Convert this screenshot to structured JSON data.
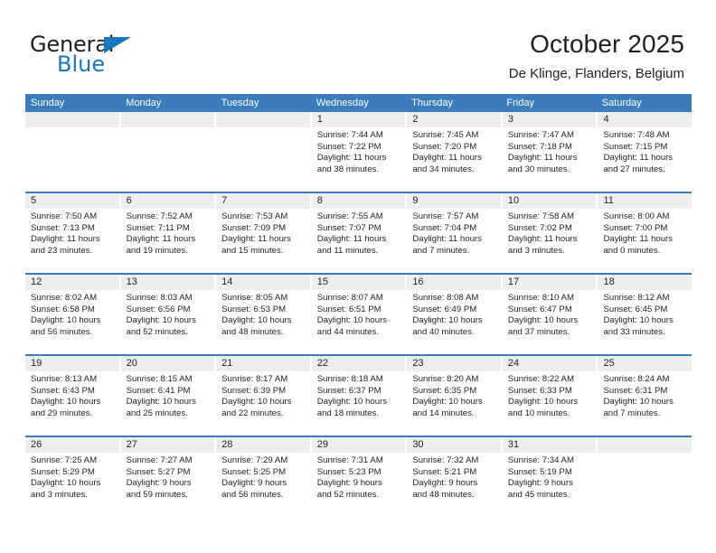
{
  "brand": {
    "name_part1": "General",
    "name_part2": "Blue",
    "accent_color": "#1878be",
    "triangle_icon": "triangle-icon"
  },
  "header": {
    "title": "October 2025",
    "location": "De Klinge, Flanders, Belgium",
    "header_bg_color": "#3b7cbd",
    "daynum_bg_color": "#eeeeee"
  },
  "weekdays": [
    "Sunday",
    "Monday",
    "Tuesday",
    "Wednesday",
    "Thursday",
    "Friday",
    "Saturday"
  ],
  "weeks": [
    [
      {
        "day": "",
        "lines": []
      },
      {
        "day": "",
        "lines": []
      },
      {
        "day": "",
        "lines": []
      },
      {
        "day": "1",
        "lines": [
          "Sunrise: 7:44 AM",
          "Sunset: 7:22 PM",
          "Daylight: 11 hours",
          "and 38 minutes."
        ]
      },
      {
        "day": "2",
        "lines": [
          "Sunrise: 7:45 AM",
          "Sunset: 7:20 PM",
          "Daylight: 11 hours",
          "and 34 minutes."
        ]
      },
      {
        "day": "3",
        "lines": [
          "Sunrise: 7:47 AM",
          "Sunset: 7:18 PM",
          "Daylight: 11 hours",
          "and 30 minutes."
        ]
      },
      {
        "day": "4",
        "lines": [
          "Sunrise: 7:48 AM",
          "Sunset: 7:15 PM",
          "Daylight: 11 hours",
          "and 27 minutes."
        ]
      }
    ],
    [
      {
        "day": "5",
        "lines": [
          "Sunrise: 7:50 AM",
          "Sunset: 7:13 PM",
          "Daylight: 11 hours",
          "and 23 minutes."
        ]
      },
      {
        "day": "6",
        "lines": [
          "Sunrise: 7:52 AM",
          "Sunset: 7:11 PM",
          "Daylight: 11 hours",
          "and 19 minutes."
        ]
      },
      {
        "day": "7",
        "lines": [
          "Sunrise: 7:53 AM",
          "Sunset: 7:09 PM",
          "Daylight: 11 hours",
          "and 15 minutes."
        ]
      },
      {
        "day": "8",
        "lines": [
          "Sunrise: 7:55 AM",
          "Sunset: 7:07 PM",
          "Daylight: 11 hours",
          "and 11 minutes."
        ]
      },
      {
        "day": "9",
        "lines": [
          "Sunrise: 7:57 AM",
          "Sunset: 7:04 PM",
          "Daylight: 11 hours",
          "and 7 minutes."
        ]
      },
      {
        "day": "10",
        "lines": [
          "Sunrise: 7:58 AM",
          "Sunset: 7:02 PM",
          "Daylight: 11 hours",
          "and 3 minutes."
        ]
      },
      {
        "day": "11",
        "lines": [
          "Sunrise: 8:00 AM",
          "Sunset: 7:00 PM",
          "Daylight: 11 hours",
          "and 0 minutes."
        ]
      }
    ],
    [
      {
        "day": "12",
        "lines": [
          "Sunrise: 8:02 AM",
          "Sunset: 6:58 PM",
          "Daylight: 10 hours",
          "and 56 minutes."
        ]
      },
      {
        "day": "13",
        "lines": [
          "Sunrise: 8:03 AM",
          "Sunset: 6:56 PM",
          "Daylight: 10 hours",
          "and 52 minutes."
        ]
      },
      {
        "day": "14",
        "lines": [
          "Sunrise: 8:05 AM",
          "Sunset: 6:53 PM",
          "Daylight: 10 hours",
          "and 48 minutes."
        ]
      },
      {
        "day": "15",
        "lines": [
          "Sunrise: 8:07 AM",
          "Sunset: 6:51 PM",
          "Daylight: 10 hours",
          "and 44 minutes."
        ]
      },
      {
        "day": "16",
        "lines": [
          "Sunrise: 8:08 AM",
          "Sunset: 6:49 PM",
          "Daylight: 10 hours",
          "and 40 minutes."
        ]
      },
      {
        "day": "17",
        "lines": [
          "Sunrise: 8:10 AM",
          "Sunset: 6:47 PM",
          "Daylight: 10 hours",
          "and 37 minutes."
        ]
      },
      {
        "day": "18",
        "lines": [
          "Sunrise: 8:12 AM",
          "Sunset: 6:45 PM",
          "Daylight: 10 hours",
          "and 33 minutes."
        ]
      }
    ],
    [
      {
        "day": "19",
        "lines": [
          "Sunrise: 8:13 AM",
          "Sunset: 6:43 PM",
          "Daylight: 10 hours",
          "and 29 minutes."
        ]
      },
      {
        "day": "20",
        "lines": [
          "Sunrise: 8:15 AM",
          "Sunset: 6:41 PM",
          "Daylight: 10 hours",
          "and 25 minutes."
        ]
      },
      {
        "day": "21",
        "lines": [
          "Sunrise: 8:17 AM",
          "Sunset: 6:39 PM",
          "Daylight: 10 hours",
          "and 22 minutes."
        ]
      },
      {
        "day": "22",
        "lines": [
          "Sunrise: 8:18 AM",
          "Sunset: 6:37 PM",
          "Daylight: 10 hours",
          "and 18 minutes."
        ]
      },
      {
        "day": "23",
        "lines": [
          "Sunrise: 8:20 AM",
          "Sunset: 6:35 PM",
          "Daylight: 10 hours",
          "and 14 minutes."
        ]
      },
      {
        "day": "24",
        "lines": [
          "Sunrise: 8:22 AM",
          "Sunset: 6:33 PM",
          "Daylight: 10 hours",
          "and 10 minutes."
        ]
      },
      {
        "day": "25",
        "lines": [
          "Sunrise: 8:24 AM",
          "Sunset: 6:31 PM",
          "Daylight: 10 hours",
          "and 7 minutes."
        ]
      }
    ],
    [
      {
        "day": "26",
        "lines": [
          "Sunrise: 7:25 AM",
          "Sunset: 5:29 PM",
          "Daylight: 10 hours",
          "and 3 minutes."
        ]
      },
      {
        "day": "27",
        "lines": [
          "Sunrise: 7:27 AM",
          "Sunset: 5:27 PM",
          "Daylight: 9 hours",
          "and 59 minutes."
        ]
      },
      {
        "day": "28",
        "lines": [
          "Sunrise: 7:29 AM",
          "Sunset: 5:25 PM",
          "Daylight: 9 hours",
          "and 56 minutes."
        ]
      },
      {
        "day": "29",
        "lines": [
          "Sunrise: 7:31 AM",
          "Sunset: 5:23 PM",
          "Daylight: 9 hours",
          "and 52 minutes."
        ]
      },
      {
        "day": "30",
        "lines": [
          "Sunrise: 7:32 AM",
          "Sunset: 5:21 PM",
          "Daylight: 9 hours",
          "and 48 minutes."
        ]
      },
      {
        "day": "31",
        "lines": [
          "Sunrise: 7:34 AM",
          "Sunset: 5:19 PM",
          "Daylight: 9 hours",
          "and 45 minutes."
        ]
      },
      {
        "day": "",
        "lines": []
      }
    ]
  ]
}
